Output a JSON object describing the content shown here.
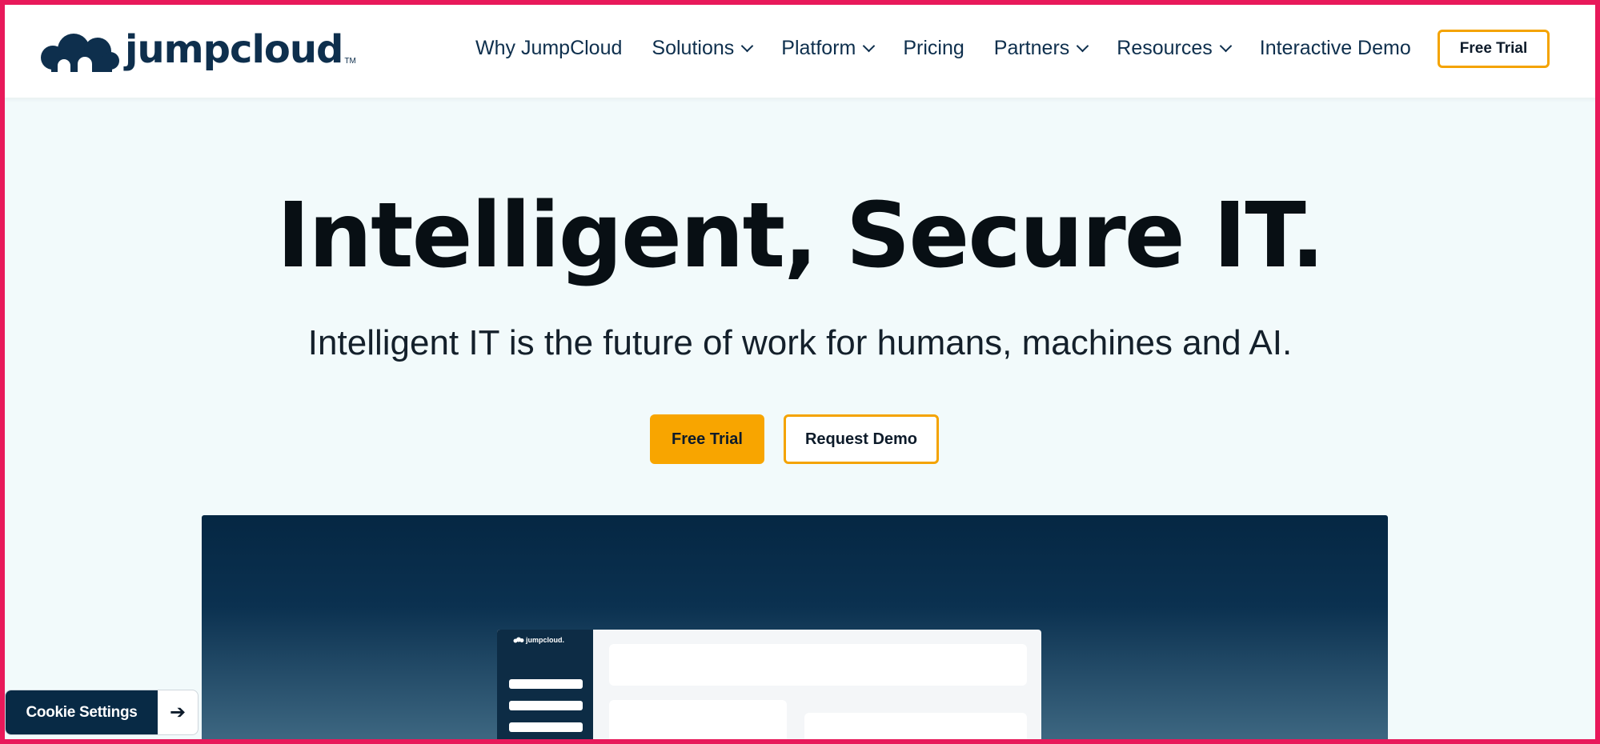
{
  "brand": {
    "name": "jumpcloud",
    "tm": "TM",
    "navy": "#0e2f4d",
    "accent": "#f8a500",
    "frame": "#e8195a"
  },
  "nav": {
    "items": [
      {
        "label": "Why JumpCloud",
        "dropdown": false
      },
      {
        "label": "Solutions",
        "dropdown": true
      },
      {
        "label": "Platform",
        "dropdown": true
      },
      {
        "label": "Pricing",
        "dropdown": false
      },
      {
        "label": "Partners",
        "dropdown": true
      },
      {
        "label": "Resources",
        "dropdown": true
      },
      {
        "label": "Interactive Demo",
        "dropdown": false
      }
    ],
    "cta_label": "Free Trial"
  },
  "hero": {
    "title": "Intelligent, Secure IT.",
    "subtitle": "Intelligent IT is the future of work for humans, machines and AI.",
    "primary_cta": "Free Trial",
    "secondary_cta": "Request Demo"
  },
  "preview": {
    "app_logo_text": "jumpcloud."
  },
  "cookie": {
    "label": "Cookie Settings",
    "icon": "arrow-right-icon"
  }
}
